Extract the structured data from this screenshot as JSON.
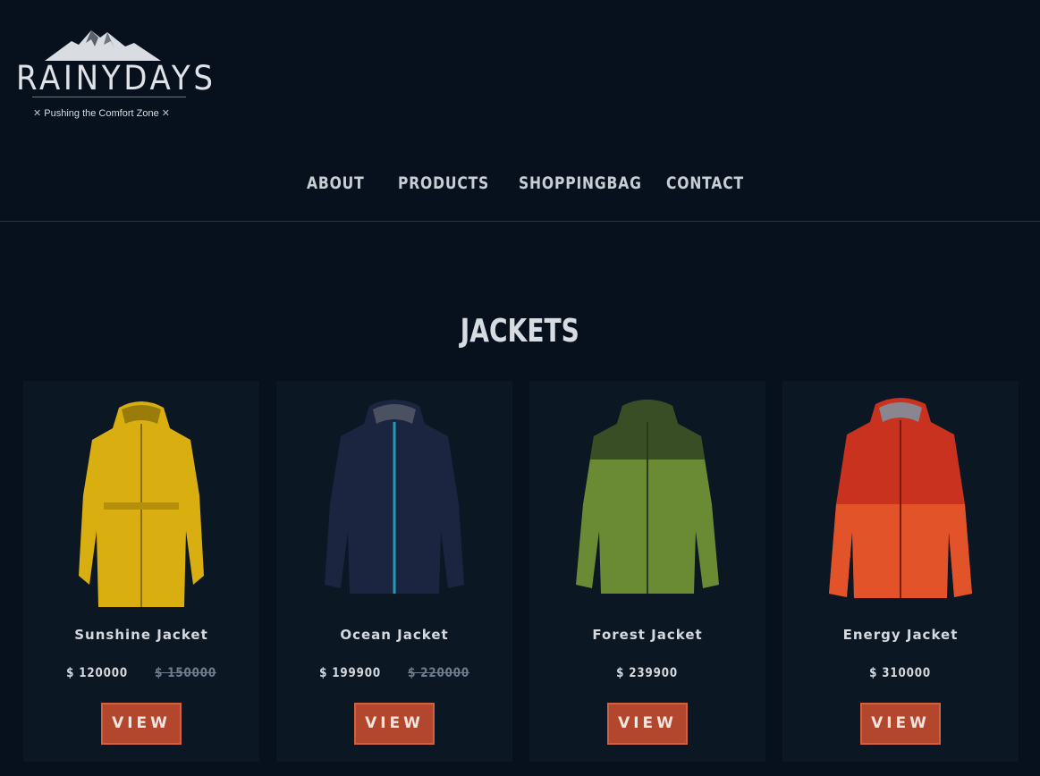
{
  "brand": {
    "name": "RAINYDAYS",
    "tagline": "Pushing the Comfort Zone",
    "tag_mark": "✕"
  },
  "nav": {
    "items": [
      {
        "label": "ABOUT"
      },
      {
        "label": "PRODUCTS"
      },
      {
        "label": "SHOPPINGBAG"
      },
      {
        "label": "CONTACT"
      }
    ]
  },
  "section": {
    "title": "JACKETS"
  },
  "products": [
    {
      "name": "Sunshine Jacket",
      "price": "$ 120000",
      "old_price": "$ 150000",
      "button": "VIEW",
      "color": "#d9ae10"
    },
    {
      "name": "Ocean Jacket",
      "price": "$ 199900",
      "old_price": "$ 220000",
      "button": "VIEW",
      "color": "#1b2540"
    },
    {
      "name": "Forest Jacket",
      "price": "$ 239900",
      "old_price": "",
      "button": "VIEW",
      "color": "#6a8a34"
    },
    {
      "name": "Energy Jacket",
      "price": "$ 310000",
      "old_price": "",
      "button": "VIEW",
      "color": "#c8321f"
    }
  ],
  "colors": {
    "background": "#07111d",
    "card": "#0c1724",
    "button": "#b2472d"
  }
}
